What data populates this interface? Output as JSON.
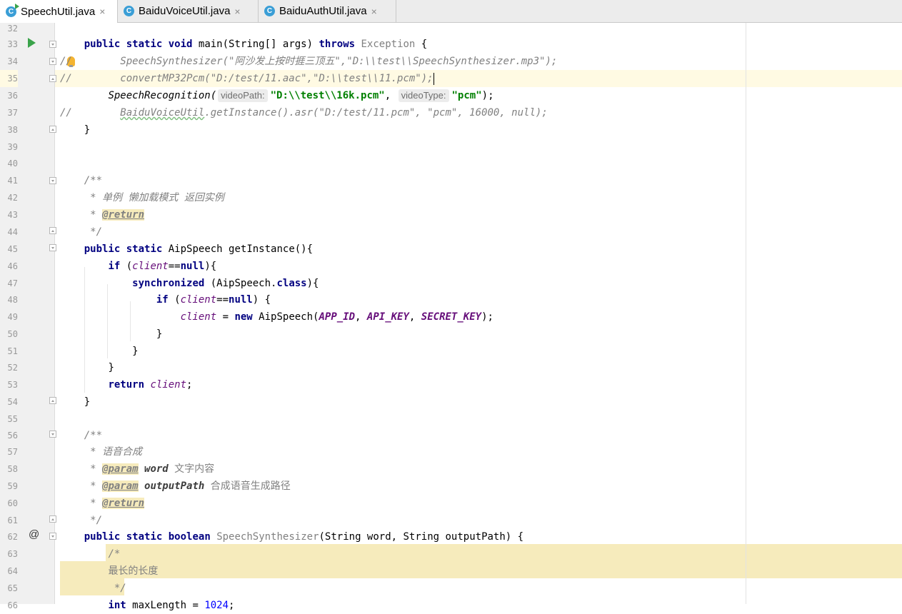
{
  "tabs": [
    {
      "label": "SpeechUtil.java",
      "icon": "java-class-icon",
      "active": true
    },
    {
      "label": "BaiduVoiceUtil.java",
      "icon": "java-class-icon",
      "active": false
    },
    {
      "label": "BaiduAuthUtil.java",
      "icon": "java-class-icon",
      "active": false
    }
  ],
  "tab_close_glyph": "×",
  "class_icon_letter": "C",
  "line_numbers": [
    "32",
    "33",
    "34",
    "35",
    "36",
    "37",
    "38",
    "39",
    "40",
    "41",
    "42",
    "43",
    "44",
    "45",
    "46",
    "47",
    "48",
    "49",
    "50",
    "51",
    "52",
    "53",
    "54",
    "55",
    "56",
    "57",
    "58",
    "59",
    "60",
    "61",
    "62",
    "63",
    "64",
    "65",
    "66"
  ],
  "gutter_markers": {
    "override_symbol": "@"
  },
  "code": {
    "l33": {
      "kw1": "public",
      "kw2": "static",
      "kw3": "void",
      "sig": " main(String[] args) ",
      "kw4": "throws",
      "exc": "Exception",
      "end": " {"
    },
    "l34": {
      "prefix": "//",
      "text": "        SpeechSynthesizer(\"阿沙发上按时捱三顶五\",\"D:\\\\test\\\\SpeechSynthesizer.mp3\");"
    },
    "l35": {
      "prefix": "//",
      "text": "        convertMP32Pcm(\"D:/test/11.aac\",\"D:\\\\test\\\\11.pcm\");"
    },
    "l36": {
      "call": "SpeechRecognition(",
      "hint1": "videoPath:",
      "str1": "\"D:\\\\test\\\\16k.pcm\"",
      "sep": ",",
      "hint2": "videoType:",
      "str2": "\"pcm\"",
      "end": ");"
    },
    "l37": {
      "prefix": "//",
      "pad": "        ",
      "cls": "BaiduVoiceUtil",
      "rest": ".getInstance().asr(\"D:/test/11.pcm\", \"pcm\", 16000, null);"
    },
    "l38": {
      "text": "}"
    },
    "l41": {
      "text": "/**"
    },
    "l42": {
      "text": " * 单例 懒加载模式 返回实例"
    },
    "l43": {
      "star": " * ",
      "tag": "@return"
    },
    "l44": {
      "text": " */"
    },
    "l45": {
      "kw1": "public",
      "kw2": "static",
      "rest": " AipSpeech getInstance(){"
    },
    "l46": {
      "kw": "if",
      "open": " (",
      "field": "client",
      "op": "==",
      "nul": "null",
      "close": "){"
    },
    "l47": {
      "kw": "synchronized",
      "mid": " (AipSpeech.",
      "cls": "class",
      "close": "){"
    },
    "l48": {
      "kw": "if",
      "open": " (",
      "field": "client",
      "op": "==",
      "nul": "null",
      "close": ") {"
    },
    "l49": {
      "field": "client",
      "eq": " = ",
      "kw": "new",
      "cls": " AipSpeech(",
      "c1": "APP_ID",
      "s1": ", ",
      "c2": "API_KEY",
      "s2": ", ",
      "c3": "SECRET_KEY",
      "end": ");"
    },
    "l50": {
      "text": "}"
    },
    "l51": {
      "text": "}"
    },
    "l52": {
      "text": "}"
    },
    "l53": {
      "kw": "return",
      "field": "client",
      "end": ";"
    },
    "l54": {
      "text": "}"
    },
    "l56": {
      "text": "/**"
    },
    "l57": {
      "text": " * 语音合成"
    },
    "l58": {
      "star": " * ",
      "tag": "@param",
      "name": " word",
      "desc": " 文字内容"
    },
    "l59": {
      "star": " * ",
      "tag": "@param",
      "name": " outputPath",
      "desc": " 合成语音生成路径"
    },
    "l60": {
      "star": " * ",
      "tag": "@return"
    },
    "l61": {
      "text": " */"
    },
    "l62": {
      "kw1": "public",
      "kw2": "static",
      "kw3": "boolean",
      "name": "SpeechSynthesizer",
      "rest": "(String word, String outputPath) {"
    },
    "l63": {
      "text": "/*"
    },
    "l64": {
      "text": "最长的长度"
    },
    "l65": {
      "text": " */"
    },
    "l66": {
      "kw": "int",
      "rest": " maxLength = ",
      "num": "1024",
      "end": ";"
    }
  }
}
